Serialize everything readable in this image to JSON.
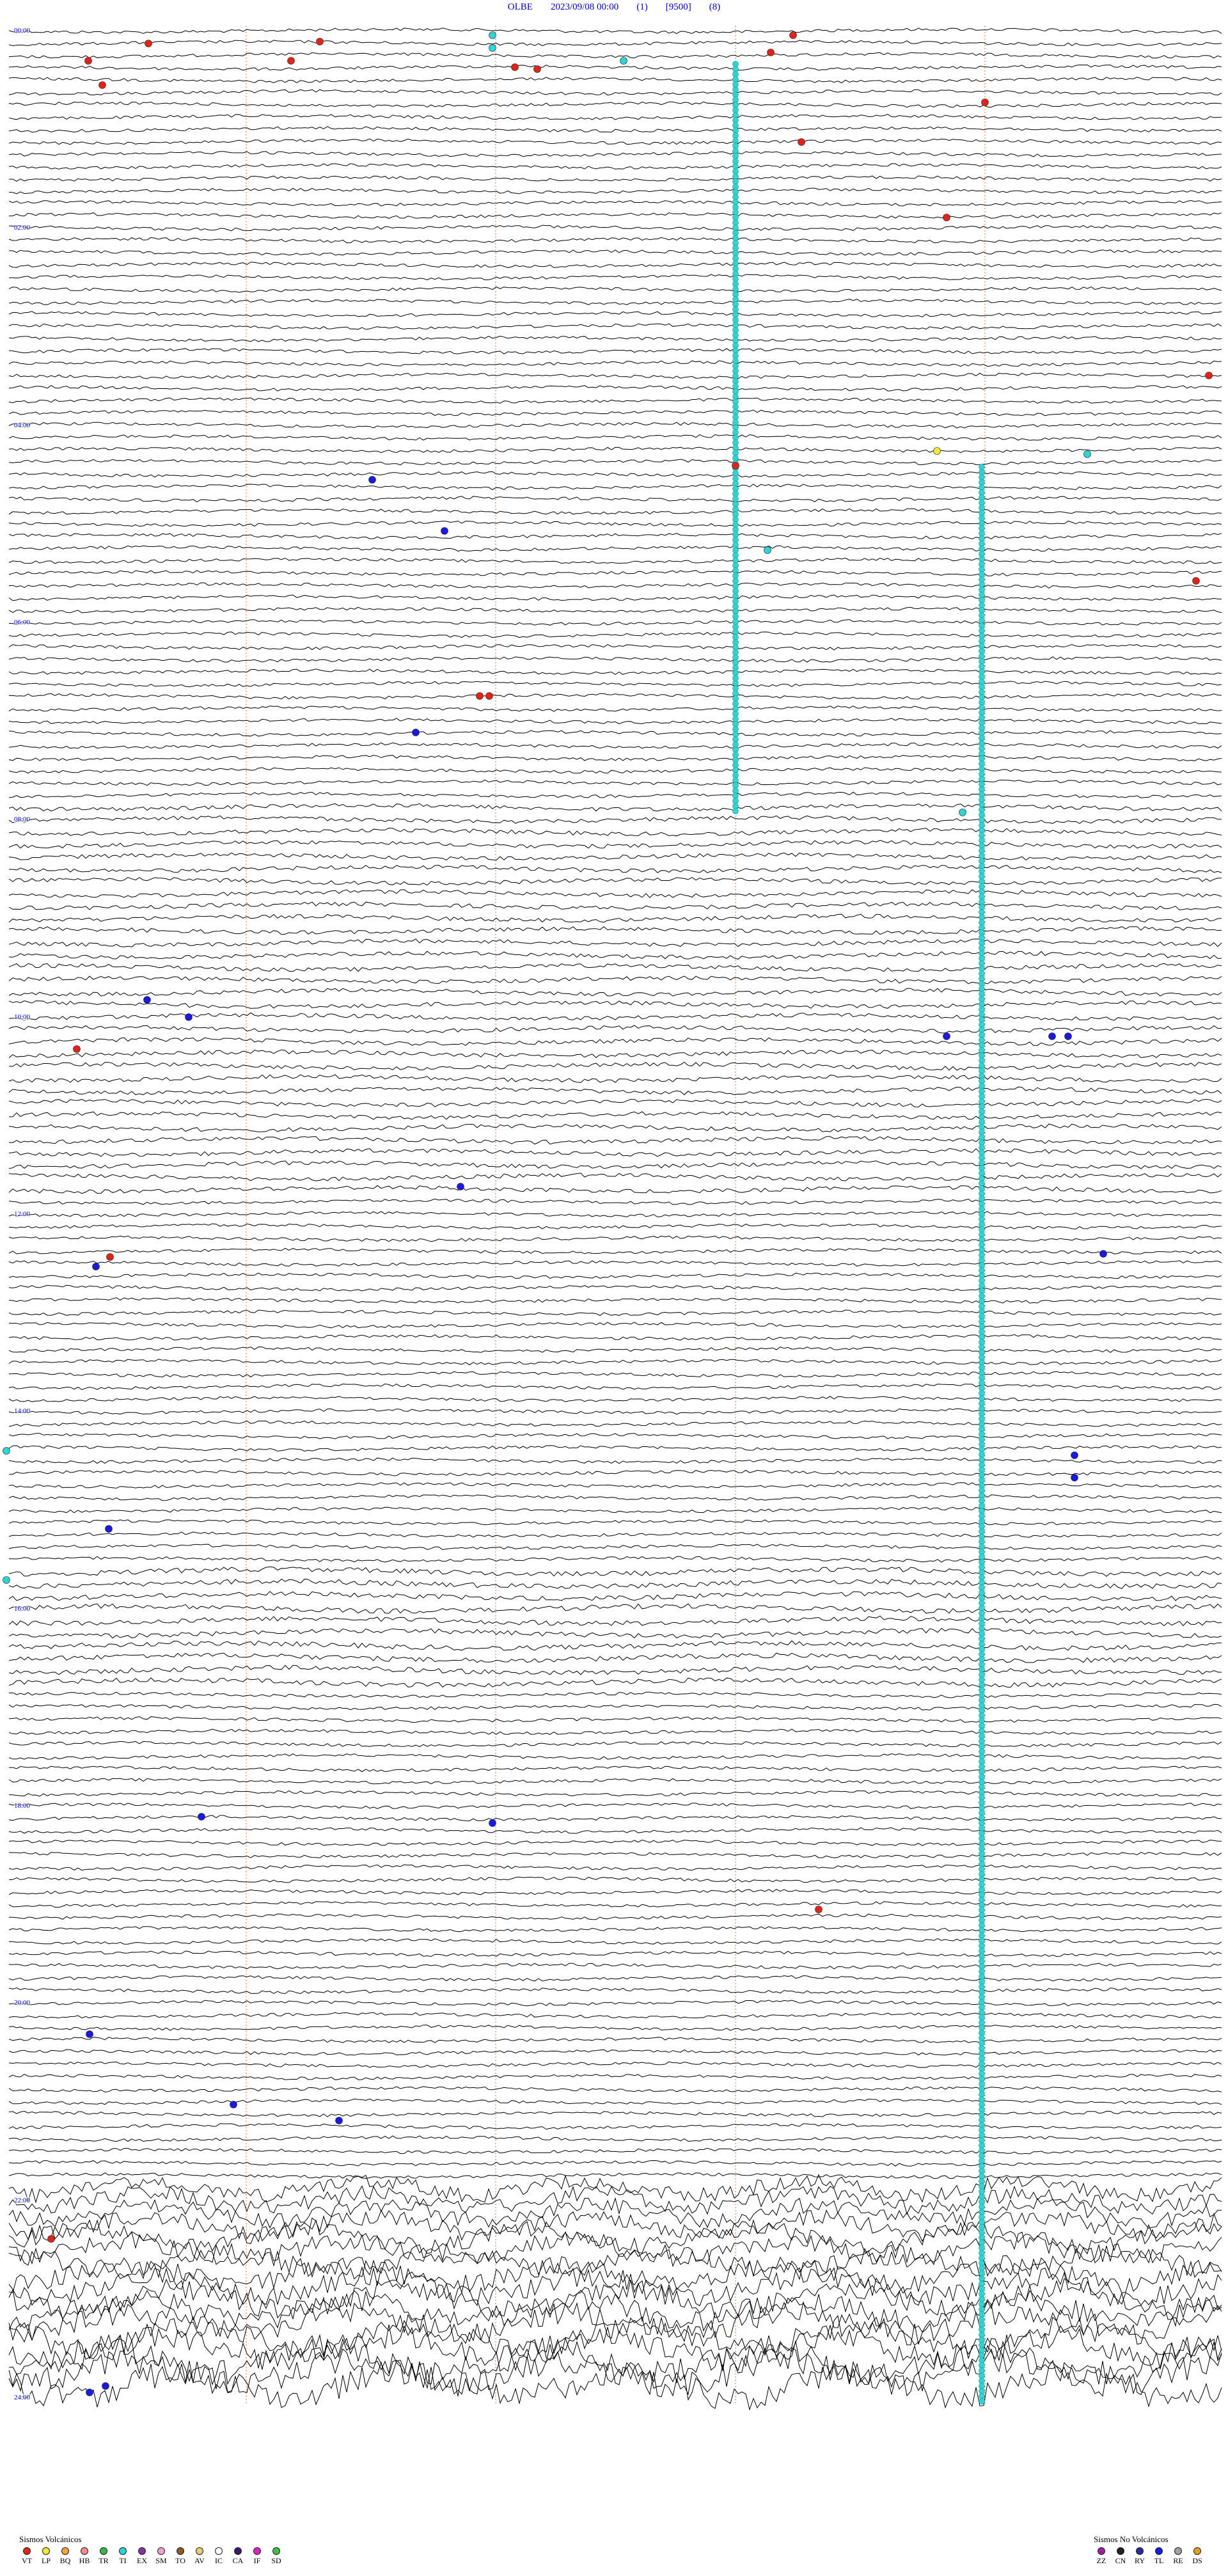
{
  "header": {
    "station": "OLBE",
    "datetime": "2023/09/08 00:00",
    "field1": "(1)",
    "field2": "[9500]",
    "field3": "(8)"
  },
  "hour_labels": [
    "00:00",
    "02:00",
    "04:00",
    "06:00",
    "08:00",
    "10:00",
    "12:00",
    "14:00",
    "16:00",
    "18:00",
    "20:00",
    "22:00",
    "24:00"
  ],
  "legend_volcanic": {
    "title": "Sismos Volcánicos",
    "items": [
      {
        "code": "VT",
        "color": "#e0241b"
      },
      {
        "code": "LP",
        "color": "#f5e83a"
      },
      {
        "code": "BQ",
        "color": "#f7a23a"
      },
      {
        "code": "HB",
        "color": "#f28c8c"
      },
      {
        "code": "TR",
        "color": "#3cb44b"
      },
      {
        "code": "TI",
        "color": "#2fd4d4"
      },
      {
        "code": "EX",
        "color": "#7a3a9a"
      },
      {
        "code": "SM",
        "color": "#f0a0d0"
      },
      {
        "code": "TO",
        "color": "#8a5a2a"
      },
      {
        "code": "AV",
        "color": "#e8d070"
      },
      {
        "code": "IC",
        "color": "#ffffff"
      },
      {
        "code": "CA",
        "color": "#3a1a6a"
      },
      {
        "code": "IF",
        "color": "#e020c0"
      },
      {
        "code": "SD",
        "color": "#40c040"
      }
    ]
  },
  "legend_nonvolcanic": {
    "title": "Sismos No Volcánicos",
    "items": [
      {
        "code": "ZZ",
        "color": "#a020a0"
      },
      {
        "code": "CN",
        "color": "#222222"
      },
      {
        "code": "RY",
        "color": "#2a2aa0"
      },
      {
        "code": "TL",
        "color": "#1a1ae0"
      },
      {
        "code": "RE",
        "color": "#a0a0a0"
      },
      {
        "code": "DS",
        "color": "#e0a020"
      }
    ]
  },
  "colors": {
    "trace": "#000000",
    "vt_marker": "#e0241b",
    "ti_marker": "#2fd4d4",
    "tl_marker": "#1a1ae0",
    "lp_marker": "#f5e83a",
    "minute_line": "#e08a5a",
    "label_blue": "#0000cc"
  }
}
